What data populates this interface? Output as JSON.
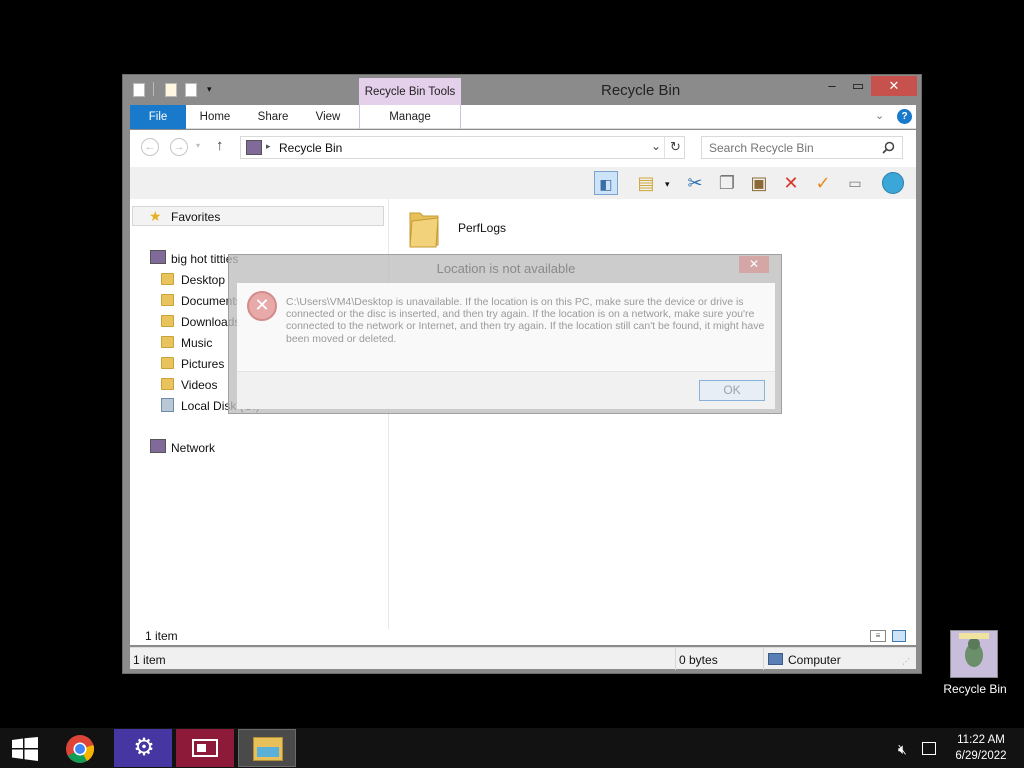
{
  "window": {
    "title": "Recycle Bin",
    "context_tab": "Recycle Bin Tools",
    "minimize_icon": "minimize-icon",
    "maximize_icon": "maximize-icon",
    "close_icon": "close-icon"
  },
  "ribbon": {
    "tabs": [
      {
        "label": "File"
      },
      {
        "label": "Home"
      },
      {
        "label": "Share"
      },
      {
        "label": "View"
      },
      {
        "label": "Manage"
      }
    ]
  },
  "address": {
    "path": "Recycle Bin",
    "search_placeholder": "Search Recycle Bin"
  },
  "nav": {
    "favorites": "Favorites",
    "pc_name": "big hot titties",
    "items": [
      {
        "label": "Desktop"
      },
      {
        "label": "Documents"
      },
      {
        "label": "Downloads"
      },
      {
        "label": "Music"
      },
      {
        "label": "Pictures"
      },
      {
        "label": "Videos"
      },
      {
        "label": "Local Disk (C:)"
      }
    ],
    "network": "Network"
  },
  "files": [
    {
      "name": "PerfLogs"
    }
  ],
  "info": {
    "item_count": "1 item"
  },
  "status": {
    "items": "1 item",
    "size": "0 bytes",
    "zone": "Computer"
  },
  "dialog": {
    "title": "Location is not available",
    "message": "C:\\Users\\VM4\\Desktop is unavailable. If the location is on this PC, make sure the device or drive is connected or the disc is inserted, and then try again. If the location is on a network, make sure you're connected to the network or Internet, and then try again. If the location still can't be found, it might have been moved or deleted.",
    "ok_label": "OK"
  },
  "desktop": {
    "recycle_bin_label": "Recycle Bin"
  },
  "taskbar": {
    "time": "11:22 AM",
    "date": "6/29/2022"
  },
  "colors": {
    "file_tab": "#1979ca",
    "context_tab": "#e4d0ea",
    "close_button": "#c7514c",
    "taskbar": "#121212"
  }
}
